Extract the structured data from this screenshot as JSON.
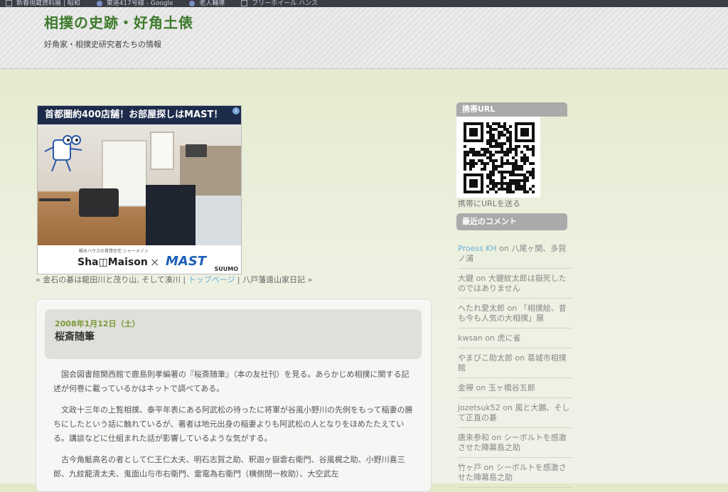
{
  "bookmarks": [
    {
      "label": "新春現蔵資料展 | 昭和",
      "icon": "page-icon"
    },
    {
      "label": "東道417号線 - Google",
      "icon": "map-icon"
    },
    {
      "label": "老人輔導",
      "icon": "globe-icon"
    },
    {
      "label": "フリーホイール ハンス",
      "icon": "page-icon"
    }
  ],
  "header": {
    "site_title": "相撲の史跡・好角土俵",
    "tagline": "好角家・相撲史研究者たちの情報"
  },
  "ad": {
    "headline": "首都圏約400店舗！お部屋探しはMAST！",
    "small_text": "積水ハウスの賃貸住宅 シャーメゾン",
    "brand1": "Sha◫Maison",
    "times": "×",
    "brand2": "MAST",
    "suumo": "SUUMO"
  },
  "post_nav": {
    "prev": "« 金石の碁は龍田川と茂り山, そして湊川",
    "sep1": " | ",
    "top": "トップページ",
    "sep2": " | ",
    "next": "八戸藩遠山家日記 »"
  },
  "post": {
    "date": "2008年1月12日（土）",
    "title": "桜斎随筆",
    "paragraphs": [
      "　国会図書館関西館で鹿島則孝編著の『桜斎随筆』（本の友社刊）を見る。あらかじめ相撲に関する記述が何巻に載っているかはネットで調べてある。",
      "　文政十三年の上覧相撲、泰平年表にある阿武松の待ったに将軍が谷風小野川の先例をもって稲妻の勝ちにしたという話に触れているが、著者は地元出身の稲妻よりも阿武松の人となりをほめたたえている。講談などに仕組まれた話が影響しているような気がする。",
      "　古今角觝高名の者として仁王仁太夫、明石志賀之助、釈迦ヶ嶽雲右衛門、谷風梶之助、小野川喜三郎、九紋龍清太夫、鬼面山与市右衛門、雷電為右衛門（横側閉一枚助）、大空武左"
    ]
  },
  "sidebar": {
    "qr_heading": "携帯URL",
    "qr_caption": "携帯にURLを送る",
    "comments_heading": "最近のコメント",
    "comments": [
      {
        "author": "Proess KH",
        "on": " on ",
        "post": "八尾ヶ関、多賀ノ浦",
        "author_linked": true
      },
      {
        "author": "大鍵",
        "on": " on ",
        "post": "大鍵紋太郎は嶽死したのではありません",
        "author_linked": false
      },
      {
        "author": "へたれ愛太郎",
        "on": " on ",
        "post": "「相撲絵、昔も今も人気の大相撲」展",
        "author_linked": false
      },
      {
        "author": "kwsan",
        "on": " on ",
        "post": "虎に雀",
        "author_linked": false
      },
      {
        "author": "やまびこ助太郎",
        "on": " on ",
        "post": "葛城市相撲館",
        "author_linked": false
      },
      {
        "author": "金襷",
        "on": " on ",
        "post": "玉ヶ橋谷五郎",
        "author_linked": false
      },
      {
        "author": "jozetsuk52",
        "on": " on ",
        "post": "風と大鵬、そして正直の碁",
        "author_linked": false
      },
      {
        "author": "唐来参和",
        "on": " on ",
        "post": "シーボルトを感激させた陣幕島之助",
        "author_linked": false
      },
      {
        "author": "竹ヶ戸",
        "on": " on ",
        "post": "シーボルトを感激させた陣幕島之助",
        "author_linked": false
      }
    ]
  }
}
